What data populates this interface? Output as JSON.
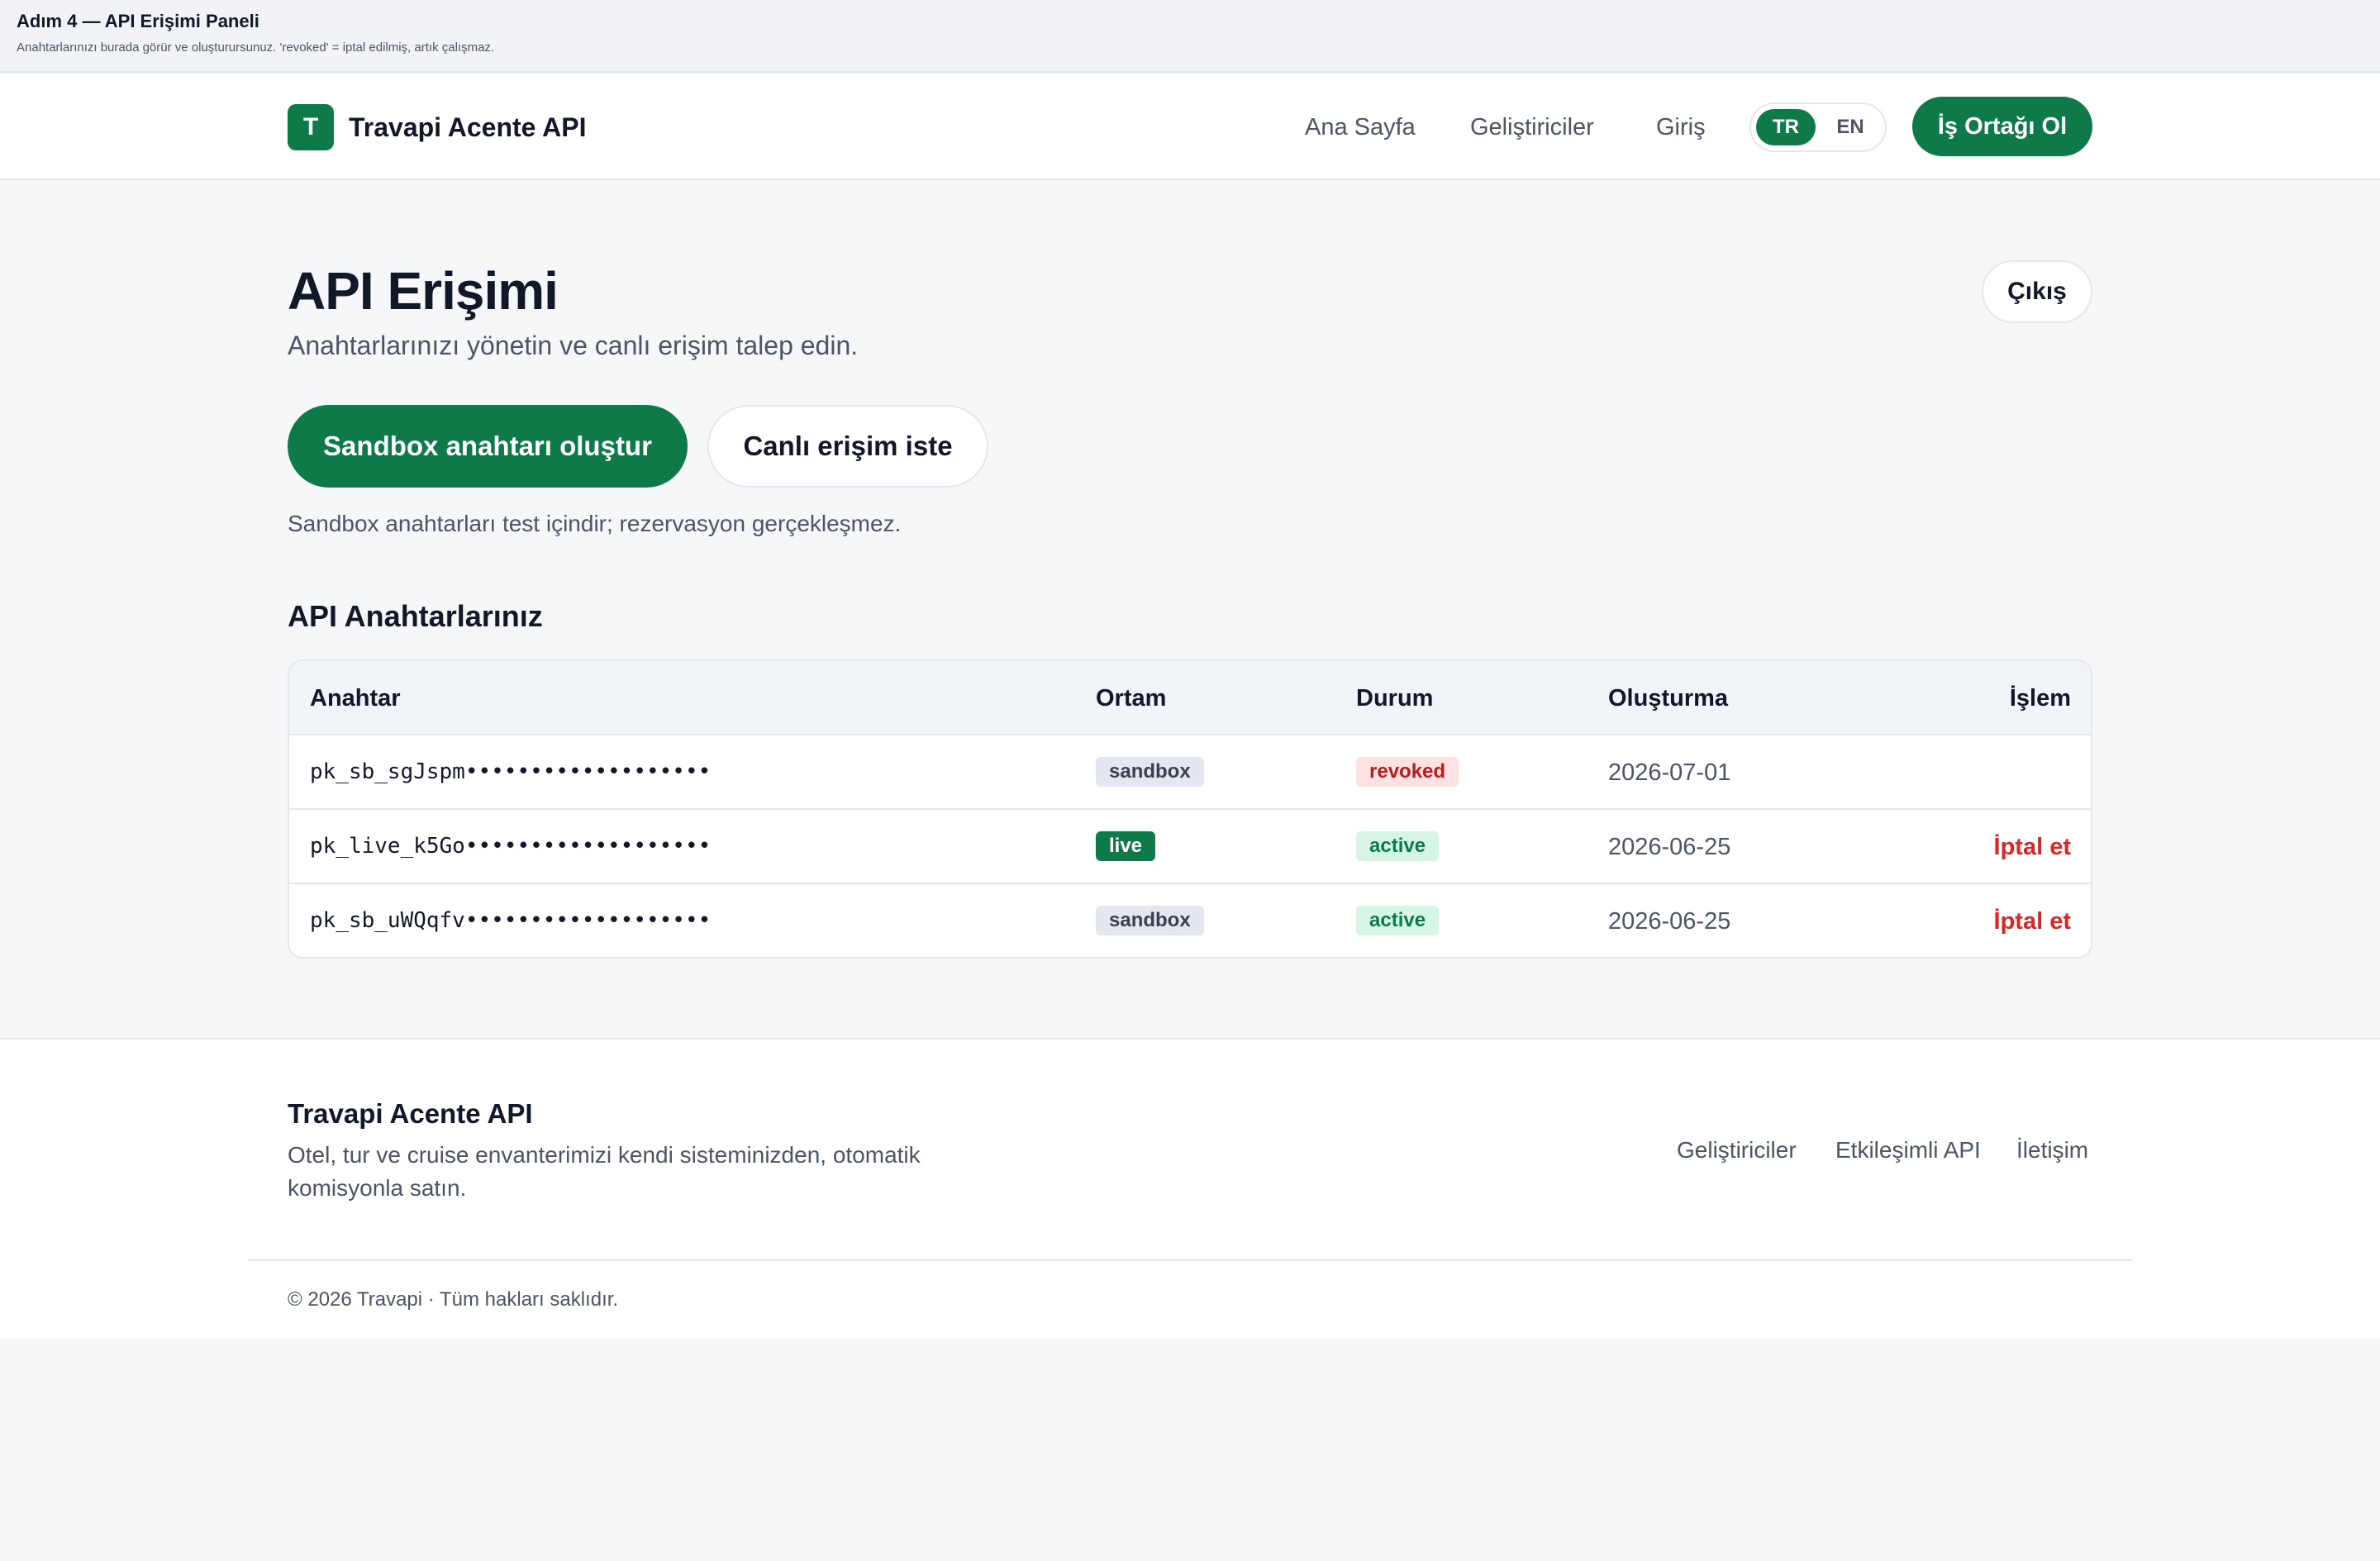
{
  "banner": {
    "title": "Adım 4 — API Erişimi Paneli",
    "description": "Anahtarlarınızı burada görür ve oluşturursunuz. 'revoked' = iptal edilmiş, artık çalışmaz."
  },
  "header": {
    "logo_letter": "T",
    "brand": "Travapi Acente API",
    "nav": [
      "Ana Sayfa",
      "Geliştiriciler",
      "Giriş"
    ],
    "lang_active": "TR",
    "lang_inactive": "EN",
    "cta": "İş Ortağı Ol"
  },
  "main": {
    "title": "API Erişimi",
    "subtitle": "Anahtarlarınızı yönetin ve canlı erişim talep edin.",
    "logout": "Çıkış",
    "primary_button": "Sandbox anahtarı oluştur",
    "secondary_button": "Canlı erişim iste",
    "note": "Sandbox anahtarları test içindir; rezervasyon gerçekleşmez.",
    "section_title": "API Anahtarlarınız"
  },
  "table": {
    "headers": [
      "Anahtar",
      "Ortam",
      "Durum",
      "Oluşturma",
      "İşlem"
    ],
    "rows": [
      {
        "key": "pk_sb_sgJspm•••••••••••••••••••",
        "env": "sandbox",
        "status": "revoked",
        "created": "2026-07-01",
        "action": ""
      },
      {
        "key": "pk_live_k5Go•••••••••••••••••••",
        "env": "live",
        "status": "active",
        "created": "2026-06-25",
        "action": "İptal et"
      },
      {
        "key": "pk_sb_uWQqfv•••••••••••••••••••",
        "env": "sandbox",
        "status": "active",
        "created": "2026-06-25",
        "action": "İptal et"
      }
    ]
  },
  "footer": {
    "brand": "Travapi Acente API",
    "description": "Otel, tur ve cruise envanterimizi kendi sisteminizden, otomatik komisyonla satın.",
    "links": [
      "Geliştiriciler",
      "Etkileşimli API",
      "İletişim"
    ],
    "copyright": "© 2026 Travapi · Tüm hakları saklıdır."
  },
  "colors": {
    "brand_green": "#0e7a4a",
    "danger_red": "#dc2626",
    "background": "#f6f7f9"
  }
}
